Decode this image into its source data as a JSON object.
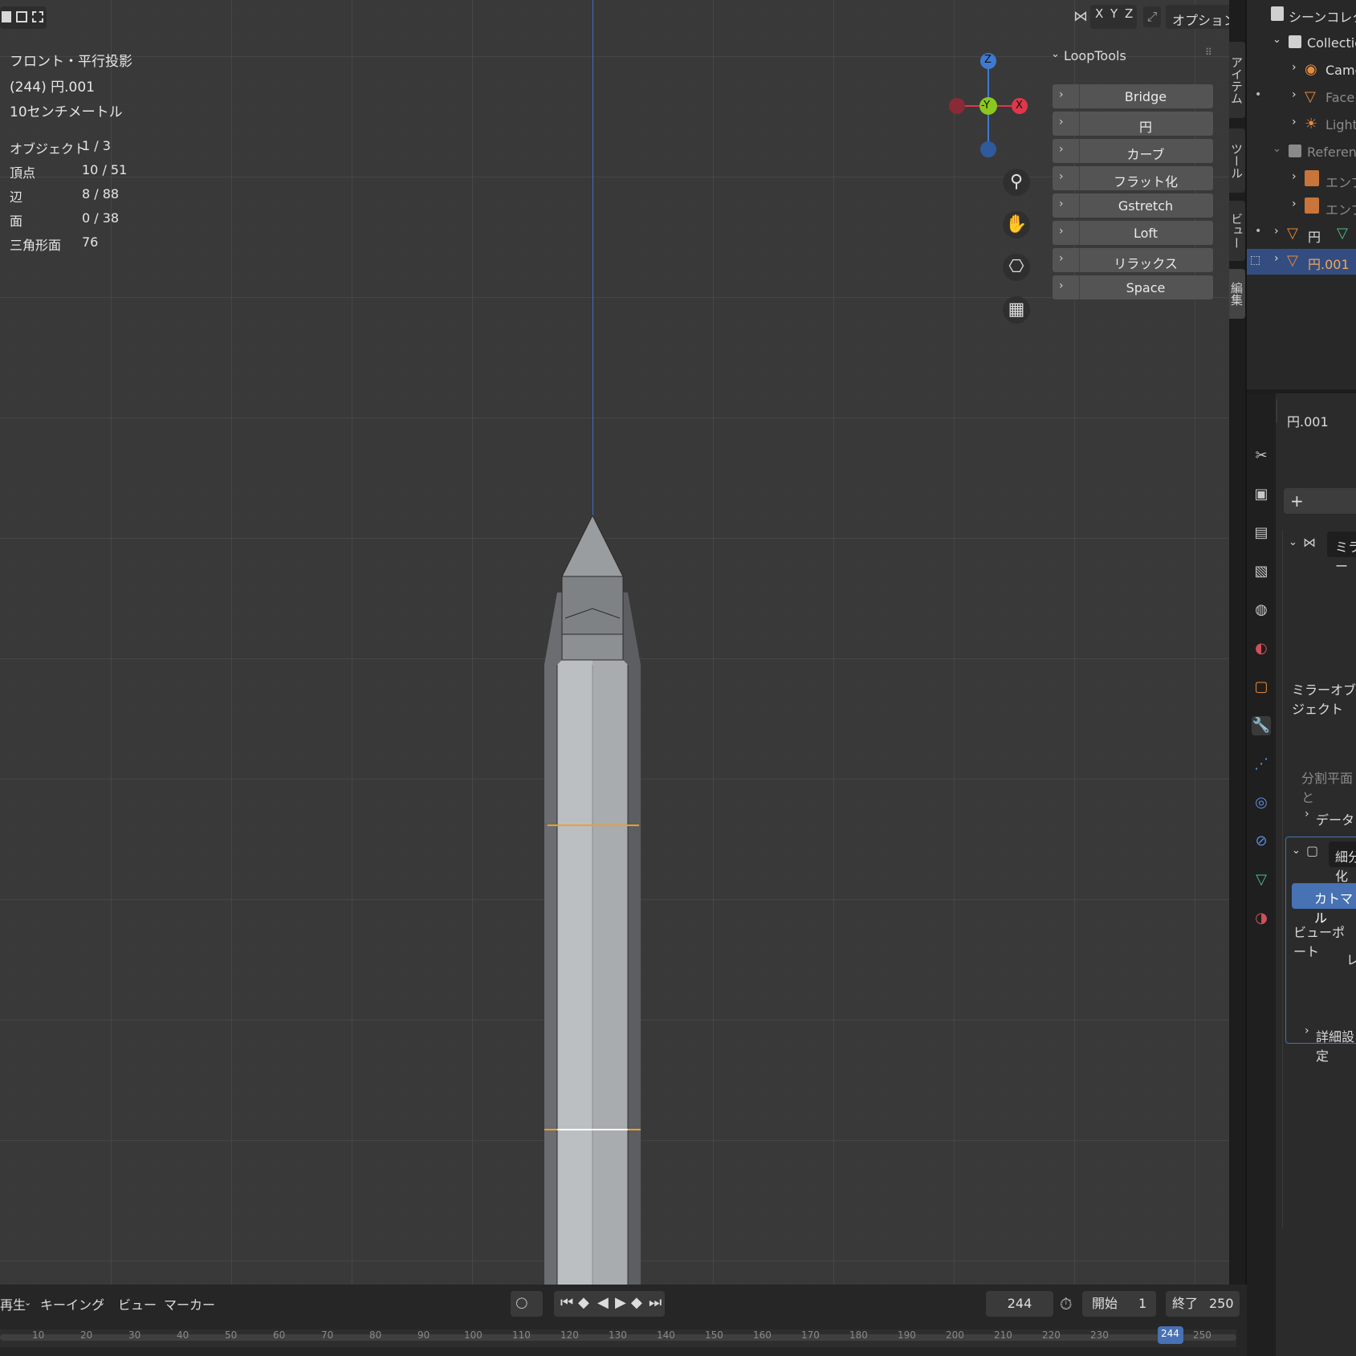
{
  "viewport": {
    "overlay_lines": [
      "フロント・平行投影",
      "(244) 円.001",
      "10センチメートル"
    ],
    "stats": [
      {
        "label": "オブジェクト",
        "value": "1 / 3"
      },
      {
        "label": "頂点",
        "value": "10 / 51"
      },
      {
        "label": "辺",
        "value": "8 / 88"
      },
      {
        "label": "面",
        "value": "0 / 38"
      },
      {
        "label": "三角形面",
        "value": "76"
      }
    ],
    "header": {
      "x": "X",
      "y": "Y",
      "z": "Z",
      "options": "オプション"
    },
    "gizmo": {
      "z": "Z",
      "y": "-Y",
      "x": "X"
    }
  },
  "looptools": {
    "title": "LoopTools",
    "items": [
      "Bridge",
      "円",
      "カーブ",
      "フラット化",
      "Gstretch",
      "Loft",
      "リラックス",
      "Space"
    ]
  },
  "side_tabs": [
    "アイテム",
    "ツール",
    "ビュー",
    "編集"
  ],
  "outliner": {
    "header": "シーンコレクション",
    "rows": [
      {
        "label": "Collection",
        "icon": "collection-icon"
      },
      {
        "label": "Camera",
        "icon": "camera-icon"
      },
      {
        "label": "Face",
        "icon": "mesh-icon"
      },
      {
        "label": "Light",
        "icon": "light-icon"
      },
      {
        "label": "Reference",
        "icon": "collection-icon"
      },
      {
        "label": "エンプティ",
        "icon": "image-empty-icon"
      },
      {
        "label": "エンプティ",
        "icon": "image-empty-icon"
      },
      {
        "label": "円",
        "icon": "mesh-icon"
      },
      {
        "label": "円.001",
        "icon": "mesh-icon"
      }
    ]
  },
  "properties": {
    "object_name": "円.001",
    "add_label": "+",
    "modifier1": "ミラー",
    "mirror_object": "ミラーオブジェクト",
    "bisect": "分割平面と",
    "data": "データ",
    "modifier2": "細分化",
    "catmull": "カトマル",
    "viewport": "ビューポート",
    "render": "レ",
    "advanced": "詳細設定"
  },
  "timeline": {
    "menus": [
      "再生",
      "キーイング",
      "ビュー",
      "マーカー"
    ],
    "current_frame": "244",
    "start_label": "開始",
    "start": "1",
    "end_label": "終了",
    "end": "250",
    "ticks": [
      "10",
      "20",
      "30",
      "40",
      "50",
      "60",
      "70",
      "80",
      "90",
      "100",
      "110",
      "120",
      "130",
      "140",
      "150",
      "160",
      "170",
      "180",
      "190",
      "200",
      "210",
      "220",
      "230",
      "244",
      "250"
    ]
  },
  "colors": {
    "accent": "#4772b3",
    "selected_edge": "#f0a020",
    "axis_x": "#e0364b",
    "axis_y": "#8bc820",
    "axis_z": "#3f7ad0"
  }
}
